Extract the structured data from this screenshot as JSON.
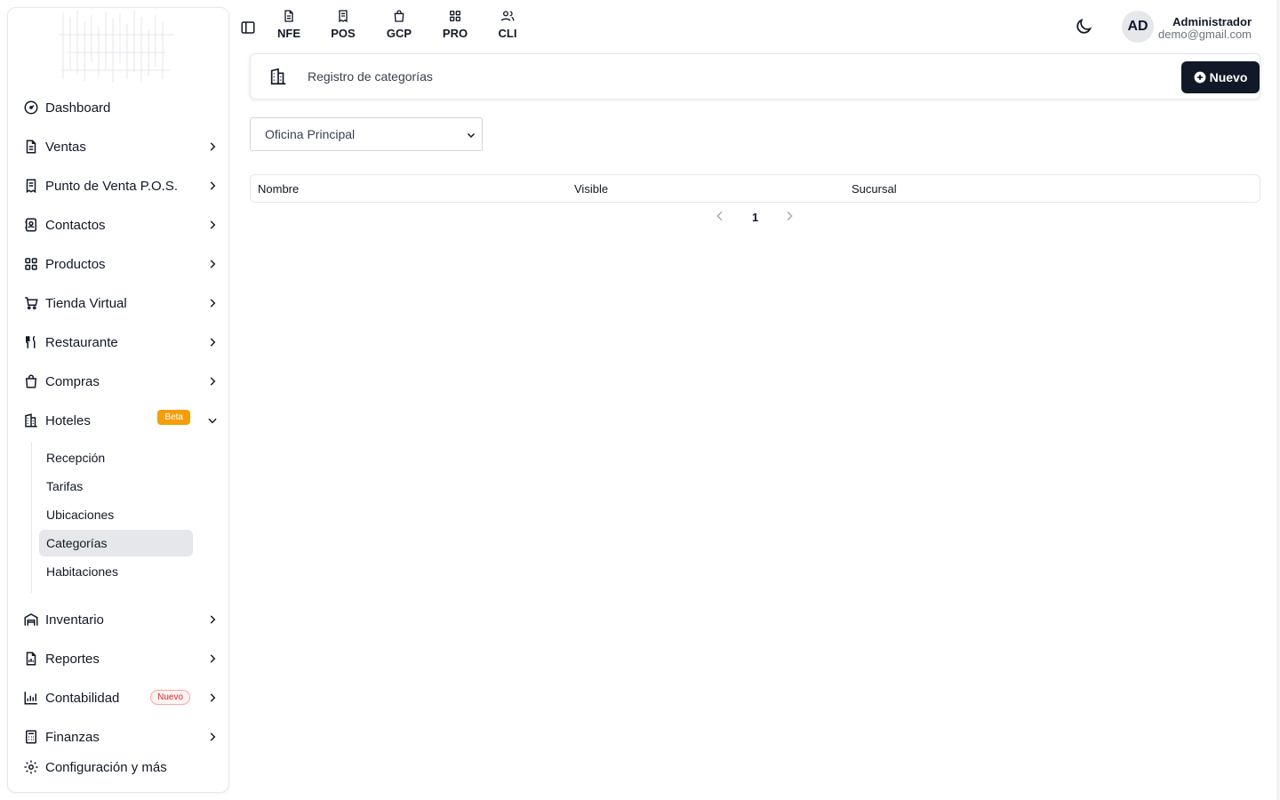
{
  "sidebar": {
    "items": [
      {
        "label": "Dashboard",
        "icon": "gauge-icon"
      },
      {
        "label": "Ventas",
        "icon": "file-text-icon"
      },
      {
        "label": "Punto de Venta P.O.S.",
        "icon": "receipt-icon"
      },
      {
        "label": "Contactos",
        "icon": "contact-book-icon"
      },
      {
        "label": "Productos",
        "icon": "grid-icon"
      },
      {
        "label": "Tienda Virtual",
        "icon": "cart-icon"
      },
      {
        "label": "Restaurante",
        "icon": "utensils-icon"
      },
      {
        "label": "Compras",
        "icon": "shopping-bag-icon"
      },
      {
        "label": "Hoteles",
        "icon": "building-icon",
        "badge": "Beta"
      },
      {
        "label": "Inventario",
        "icon": "warehouse-icon"
      },
      {
        "label": "Reportes",
        "icon": "report-icon"
      },
      {
        "label": "Contabilidad",
        "icon": "bar-chart-icon",
        "badge": "Nuevo"
      },
      {
        "label": "Finanzas",
        "icon": "calculator-icon"
      },
      {
        "label": "Configuración y más",
        "icon": "gear-icon"
      }
    ],
    "hoteles_sub": [
      "Recepción",
      "Tarifas",
      "Ubicaciones",
      "Categorías",
      "Habitaciones"
    ],
    "active_sub": "Categorías"
  },
  "topbar": {
    "quick_links": [
      "NFE",
      "POS",
      "GCP",
      "PRO",
      "CLI"
    ],
    "avatar_initials": "AD",
    "user_name": "Administrador",
    "user_email": "demo@gmail.com"
  },
  "header": {
    "title": "Registro de categorías",
    "new_button": "Nuevo"
  },
  "filter": {
    "selected_branch": "Oficina Principal"
  },
  "table": {
    "columns": [
      "Nombre",
      "Visible",
      "Sucursal"
    ],
    "rows": []
  },
  "pagination": {
    "current_page": "1"
  },
  "colors": {
    "primary": "#111827",
    "beta_badge": "#f59e0b",
    "nuevo_badge": "#dc2626",
    "active_bg": "#e5e7eb"
  }
}
